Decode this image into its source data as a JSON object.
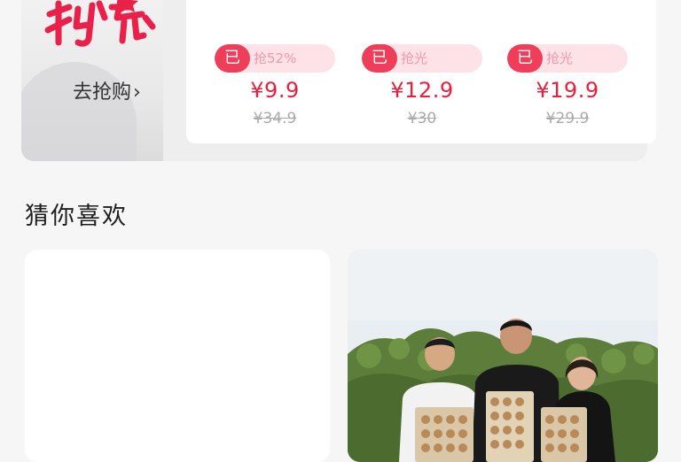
{
  "flash_sale": {
    "logo_text": "秒杀",
    "go_label": "去抢购",
    "go_chevron": "›",
    "items": [
      {
        "badge": "已",
        "status_text": "抢52%",
        "price": "¥9.9",
        "original_price": "¥34.9"
      },
      {
        "badge": "已",
        "status_text": "抢光",
        "price": "¥12.9",
        "original_price": "¥30"
      },
      {
        "badge": "已",
        "status_text": "抢光",
        "price": "¥19.9",
        "original_price": "¥29.9"
      }
    ]
  },
  "recommend": {
    "title": "猜你喜欢"
  },
  "colors": {
    "accent": "#e8203c",
    "badge": "#ef3e5a",
    "tag_bg": "#fde3e8"
  }
}
